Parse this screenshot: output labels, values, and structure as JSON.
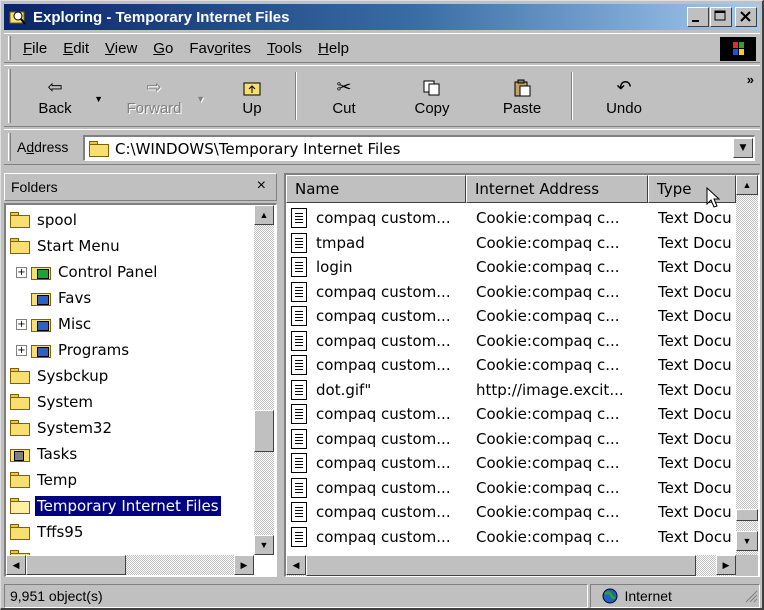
{
  "window": {
    "title": "Exploring - Temporary Internet Files"
  },
  "menubar": {
    "items": [
      {
        "label": "File",
        "accel": "F",
        "rest": "ile"
      },
      {
        "label": "Edit",
        "accel": "E",
        "rest": "dit"
      },
      {
        "label": "View",
        "accel": "V",
        "rest": "iew"
      },
      {
        "label": "Go",
        "accel": "G",
        "rest": "o"
      },
      {
        "label": "Favorites",
        "pre": "Fav",
        "accel": "o",
        "rest": "rites"
      },
      {
        "label": "Tools",
        "accel": "T",
        "rest": "ools"
      },
      {
        "label": "Help",
        "accel": "H",
        "rest": "elp"
      }
    ]
  },
  "toolbar": {
    "back": "Back",
    "forward": "Forward",
    "up": "Up",
    "cut": "Cut",
    "copy": "Copy",
    "paste": "Paste",
    "undo": "Undo",
    "more": "»"
  },
  "address": {
    "label_pre": "A",
    "label_accel": "d",
    "label_rest": "dress",
    "value": "C:\\WINDOWS\\Temporary Internet Files"
  },
  "folders": {
    "title": "Folders",
    "close": "×",
    "items": [
      {
        "label": "spool",
        "icon": "folder",
        "indent": 0
      },
      {
        "label": "Start Menu",
        "icon": "folder",
        "indent": 0
      },
      {
        "label": "Control Panel",
        "icon": "control-panel",
        "indent": 1,
        "expander": "+"
      },
      {
        "label": "Favs",
        "icon": "special-folder",
        "indent": 1
      },
      {
        "label": "Misc",
        "icon": "special-folder",
        "indent": 1,
        "expander": "+"
      },
      {
        "label": "Programs",
        "icon": "special-folder",
        "indent": 1,
        "expander": "+"
      },
      {
        "label": "Sysbckup",
        "icon": "folder",
        "indent": 0
      },
      {
        "label": "System",
        "icon": "folder",
        "indent": 0
      },
      {
        "label": "System32",
        "icon": "folder",
        "indent": 0
      },
      {
        "label": "Tasks",
        "icon": "tasks-folder",
        "indent": 0
      },
      {
        "label": "Temp",
        "icon": "folder",
        "indent": 0
      },
      {
        "label": "Temporary Internet Files",
        "icon": "folder-open",
        "indent": 0,
        "selected": true
      },
      {
        "label": "Tffs95",
        "icon": "folder",
        "indent": 0
      }
    ]
  },
  "files": {
    "columns": [
      "Name",
      "Internet Address",
      "Type"
    ],
    "rows": [
      {
        "name": "compaq custom...",
        "address": "Cookie:compaq c...",
        "type": "Text Docu"
      },
      {
        "name": "tmpad",
        "address": "Cookie:compaq c...",
        "type": "Text Docu"
      },
      {
        "name": "login",
        "address": "Cookie:compaq c...",
        "type": "Text Docu"
      },
      {
        "name": "compaq custom...",
        "address": "Cookie:compaq c...",
        "type": "Text Docu"
      },
      {
        "name": "compaq custom...",
        "address": "Cookie:compaq c...",
        "type": "Text Docu"
      },
      {
        "name": "compaq custom...",
        "address": "Cookie:compaq c...",
        "type": "Text Docu"
      },
      {
        "name": "compaq custom...",
        "address": "Cookie:compaq c...",
        "type": "Text Docu"
      },
      {
        "name": "dot.gif\"",
        "address": "http://image.excit...",
        "type": "Text Docu"
      },
      {
        "name": "compaq custom...",
        "address": "Cookie:compaq c...",
        "type": "Text Docu"
      },
      {
        "name": "compaq custom...",
        "address": "Cookie:compaq c...",
        "type": "Text Docu"
      },
      {
        "name": "compaq custom...",
        "address": "Cookie:compaq c...",
        "type": "Text Docu"
      },
      {
        "name": "compaq custom...",
        "address": "Cookie:compaq c...",
        "type": "Text Docu"
      },
      {
        "name": "compaq custom...",
        "address": "Cookie:compaq c...",
        "type": "Text Docu"
      },
      {
        "name": "compaq custom...",
        "address": "Cookie:compaq c...",
        "type": "Text Docu"
      }
    ]
  },
  "status": {
    "count": "9,951 object(s)",
    "zone": "Internet"
  },
  "colors": {
    "selection": "#000080",
    "face": "#c0c0c0",
    "titlebar": "#0a246a"
  }
}
